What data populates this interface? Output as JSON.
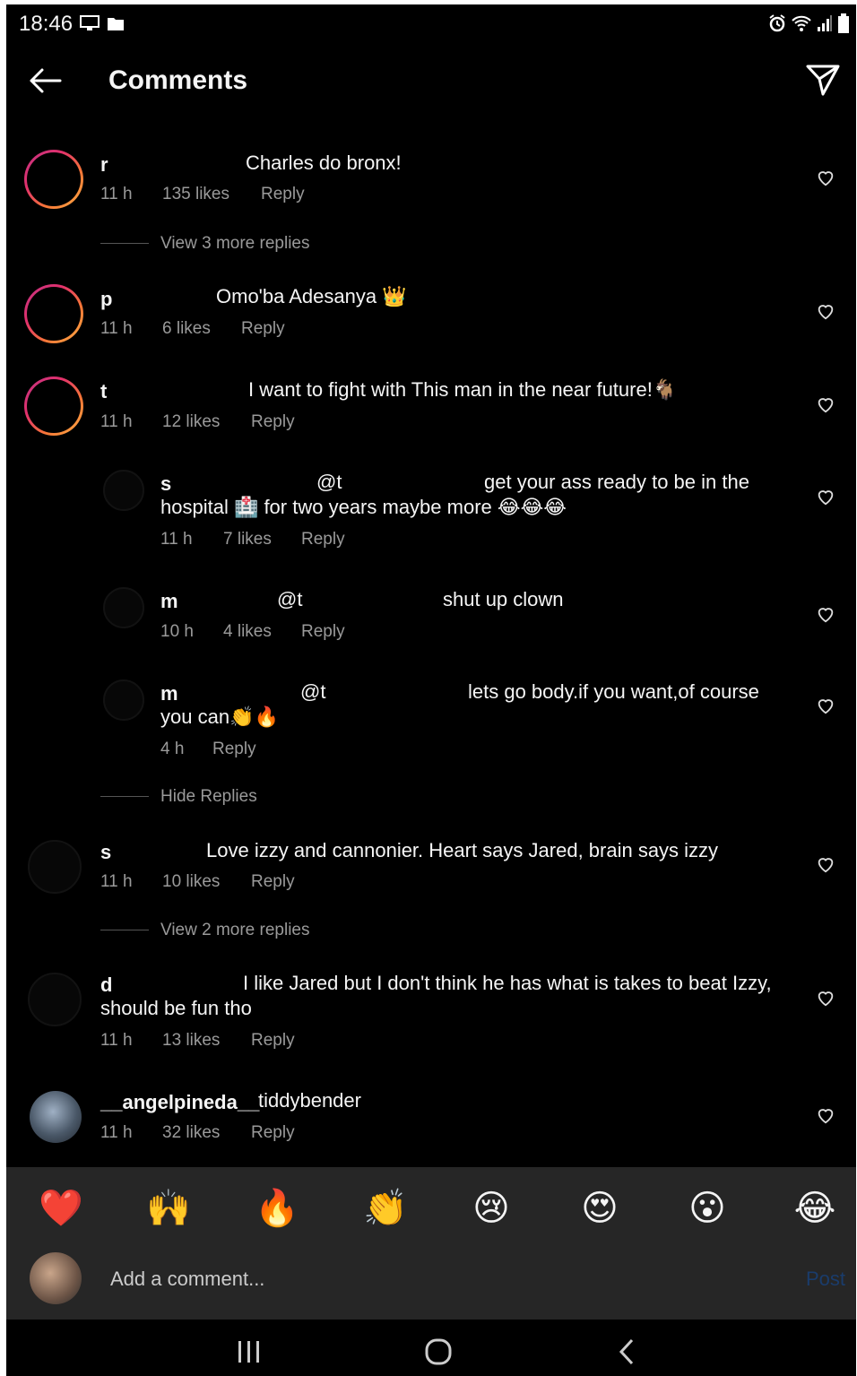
{
  "status_bar": {
    "time": "18:46",
    "left_icons": [
      "monitor-icon",
      "folder-icon"
    ],
    "right_icons": [
      "alarm-icon",
      "wifi-icon",
      "signal-icon",
      "battery-icon"
    ]
  },
  "header": {
    "title": "Comments",
    "back_icon": "arrow-left-icon",
    "share_icon": "send-icon"
  },
  "comments": [
    {
      "username": "r",
      "text": "Charles do bronx!",
      "time": "11 h",
      "likes": "135 likes",
      "reply": "Reply",
      "more": "View 3 more replies"
    },
    {
      "username": "p",
      "text": "Omo'ba Adesanya 👑",
      "time": "11 h",
      "likes": "6 likes",
      "reply": "Reply"
    },
    {
      "username": "t",
      "text": "I want to fight with This man in the near future!🐐",
      "time": "11 h",
      "likes": "12 likes",
      "reply": "Reply"
    },
    {
      "username": "s",
      "mention": "@t",
      "text_line1": "get your ass ready to be in the",
      "text_line2": "hospital 🏥 for two years maybe more 😂😂😂",
      "time": "11 h",
      "likes": "7 likes",
      "reply": "Reply"
    },
    {
      "username": "m",
      "mention": "@t",
      "text": "shut up clown",
      "time": "10 h",
      "likes": "4 likes",
      "reply": "Reply"
    },
    {
      "username": "m",
      "mention": "@t",
      "text_line1": "lets go body.if you want,of course",
      "text_line2": "you can👏🔥",
      "time": "4 h",
      "reply": "Reply",
      "more": "Hide Replies"
    },
    {
      "username": "s",
      "text": "Love izzy and cannonier. Heart says Jared, brain says izzy",
      "time": "11 h",
      "likes": "10 likes",
      "reply": "Reply",
      "more": "View 2 more replies"
    },
    {
      "username": "d",
      "text_line1": "I like Jared but I don't think he has what is takes to beat Izzy,",
      "text_line2": "should be fun tho",
      "time": "11 h",
      "likes": "13 likes",
      "reply": "Reply"
    },
    {
      "username": "__angelpineda__",
      "text": "tiddybender",
      "time": "11 h",
      "likes": "32 likes",
      "reply": "Reply"
    }
  ],
  "emoji_bar": [
    "❤️",
    "🙌",
    "🔥",
    "👏",
    "😢",
    "😍",
    "😮",
    "😂"
  ],
  "composer": {
    "placeholder": "Add a comment...",
    "post_label": "Post"
  },
  "nav_bar": [
    "recent-apps-icon",
    "home-icon",
    "back-icon"
  ]
}
